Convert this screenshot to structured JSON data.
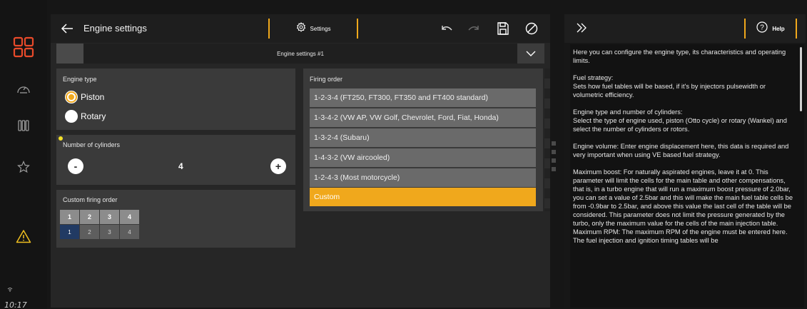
{
  "rail": {
    "clock": "10:17",
    "items": [
      {
        "icon": "grid-apps-icon",
        "active": true
      },
      {
        "icon": "gauge-icon"
      },
      {
        "icon": "columns-icon"
      },
      {
        "icon": "star-icon"
      },
      {
        "icon": "warning-icon"
      }
    ],
    "accent": "#e84a2a",
    "warning_color": "#f0c020"
  },
  "header": {
    "title": "Engine settings",
    "settings_tab": "Settings"
  },
  "profile": {
    "name": "Engine settings #1"
  },
  "engine_type": {
    "title": "Engine type",
    "options": [
      {
        "label": "Piston",
        "selected": true
      },
      {
        "label": "Rotary",
        "selected": false
      }
    ]
  },
  "cylinders": {
    "title": "Number of cylinders",
    "value": "4",
    "minus": "-",
    "plus": "+"
  },
  "custom_order": {
    "title": "Custom firing order",
    "header": [
      "1",
      "2",
      "3",
      "4"
    ],
    "values": [
      "1",
      "2",
      "3",
      "4"
    ]
  },
  "firing_order": {
    "title": "Firing order",
    "items": [
      "1-2-3-4 (FT250, FT300, FT350 and FT400 standard)",
      "1-3-4-2 (VW AP, VW Golf, Chevrolet, Ford, Fiat, Honda)",
      "1-3-2-4 (Subaru)",
      "1-4-3-2 (VW aircooled)",
      "1-2-4-3 (Most motorcycle)",
      "Custom"
    ],
    "selected_index": 5
  },
  "help": {
    "button": "Help",
    "paragraphs": [
      "Here you can configure the engine type, its characteristics and operating limits.",
      "Fuel strategy:\nSets how fuel tables will be based, if it's by injectors pulsewidth or volumetric efficiency.",
      "Engine type and number of cylinders:\nSelect the type of engine used, piston (Otto cycle) or rotary (Wankel) and select the number of cylinders or rotors.",
      "Engine volume: Enter engine displacement here, this data is required and very important when using VE based fuel strategy.",
      "Maximum boost: For naturally aspirated engines, leave it at 0. This parameter will limit the cells for the main table and other compensations, that is, in a turbo engine that will run a maximum boost pressure of 2.0bar, you can set a value of 2.5bar and this will make the main fuel table cells be from -0.9bar to 2.5bar, and above this value the last cell of the table will be considered. This parameter does not limit the pressure generated by the turbo, only the maximum value for the cells of the main injection table.\nMaximum RPM: The maximum RPM of the engine must be entered here. The fuel injection and ignition timing tables will be"
    ]
  },
  "colors": {
    "accent": "#f0a81c",
    "selected_cell": "#213a63"
  }
}
